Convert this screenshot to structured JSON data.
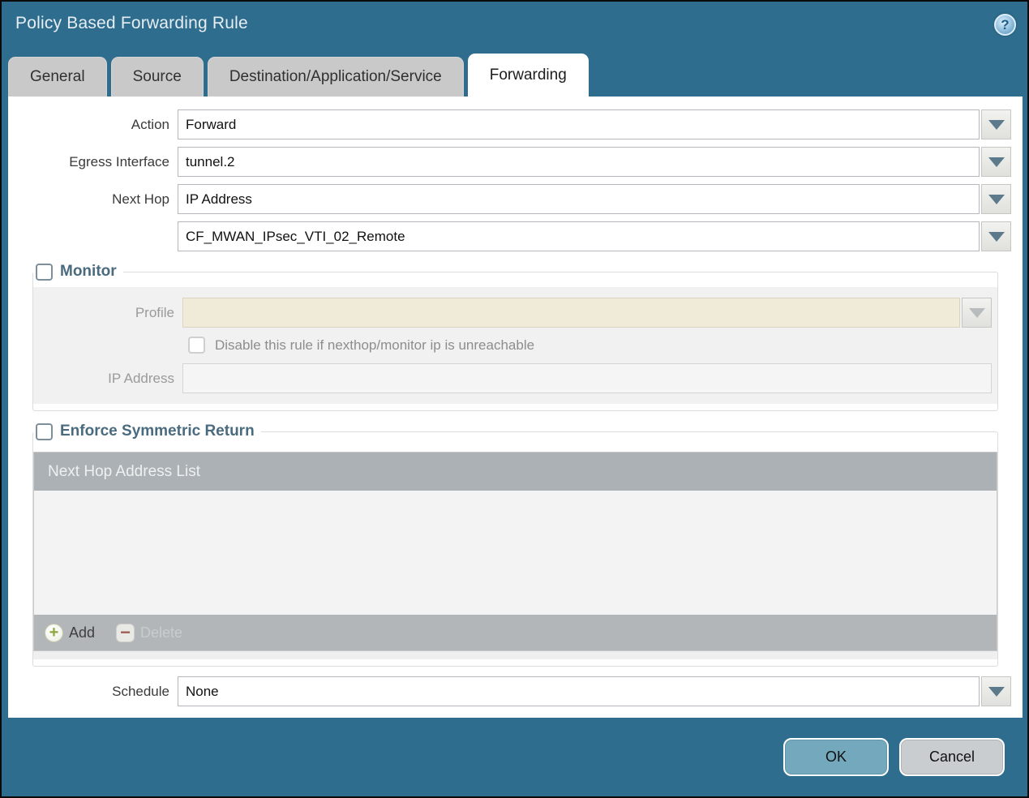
{
  "dialog": {
    "title": "Policy Based Forwarding Rule"
  },
  "icons": {
    "help_glyph": "?",
    "add_glyph": "+",
    "delete_glyph": "−"
  },
  "tabs": [
    {
      "label": "General"
    },
    {
      "label": "Source"
    },
    {
      "label": "Destination/Application/Service"
    },
    {
      "label": "Forwarding"
    }
  ],
  "active_tab": "Forwarding",
  "form": {
    "action_label": "Action",
    "action_value": "Forward",
    "egress_label": "Egress Interface",
    "egress_value": "tunnel.2",
    "next_hop_label": "Next Hop",
    "next_hop_value": "IP Address",
    "next_hop_address_value": "CF_MWAN_IPsec_VTI_02_Remote",
    "schedule_label": "Schedule",
    "schedule_value": "None"
  },
  "monitor": {
    "title": "Monitor",
    "checked": false,
    "profile_label": "Profile",
    "profile_value": "",
    "disable_label": "Disable this rule if nexthop/monitor ip is unreachable",
    "disable_checked": false,
    "ip_label": "IP Address",
    "ip_value": ""
  },
  "symmetric_return": {
    "title": "Enforce Symmetric Return",
    "checked": false,
    "table_header": "Next Hop Address List",
    "rows": [],
    "add_label": "Add",
    "delete_label": "Delete"
  },
  "footer": {
    "ok_label": "OK",
    "cancel_label": "Cancel"
  },
  "colors": {
    "frame_teal": "#2E6D8E",
    "tab_inactive": "#C9C9C9",
    "section_title": "#4A6B7E",
    "table_header_bg": "#ACB1B5",
    "table_footer_bg": "#B2B6B9",
    "profile_disabled_bg": "#F0EBD8",
    "ok_button_bg": "#74A9BD",
    "cancel_button_bg": "#C9CDD0"
  }
}
